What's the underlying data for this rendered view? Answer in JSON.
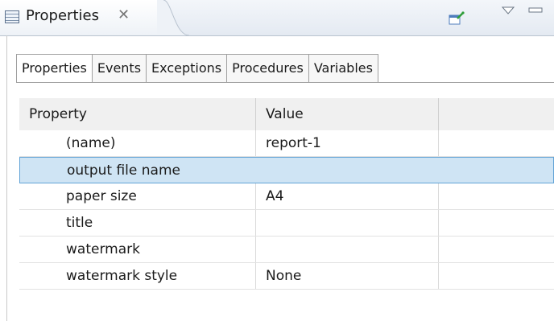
{
  "view": {
    "title": "Properties",
    "close_glyph": "✕",
    "icons": [
      "properties-view-icon",
      "pin-icon",
      "view-menu-icon",
      "minimize-icon"
    ]
  },
  "tabs": [
    {
      "label": "Properties",
      "active": true
    },
    {
      "label": "Events",
      "active": false
    },
    {
      "label": "Exceptions",
      "active": false
    },
    {
      "label": "Procedures",
      "active": false
    },
    {
      "label": "Variables",
      "active": false
    }
  ],
  "table": {
    "headers": {
      "property": "Property",
      "value": "Value"
    },
    "rows": [
      {
        "property": "(name)",
        "value": "report-1",
        "selected": false
      },
      {
        "property": "output file name",
        "value": "",
        "selected": true
      },
      {
        "property": "paper size",
        "value": "A4",
        "selected": false
      },
      {
        "property": "title",
        "value": "",
        "selected": false
      },
      {
        "property": "watermark",
        "value": "",
        "selected": false
      },
      {
        "property": "watermark style",
        "value": "None",
        "selected": false
      }
    ]
  },
  "colors": {
    "selection": "#cfe4f4",
    "selection_border": "#62a3d6"
  }
}
